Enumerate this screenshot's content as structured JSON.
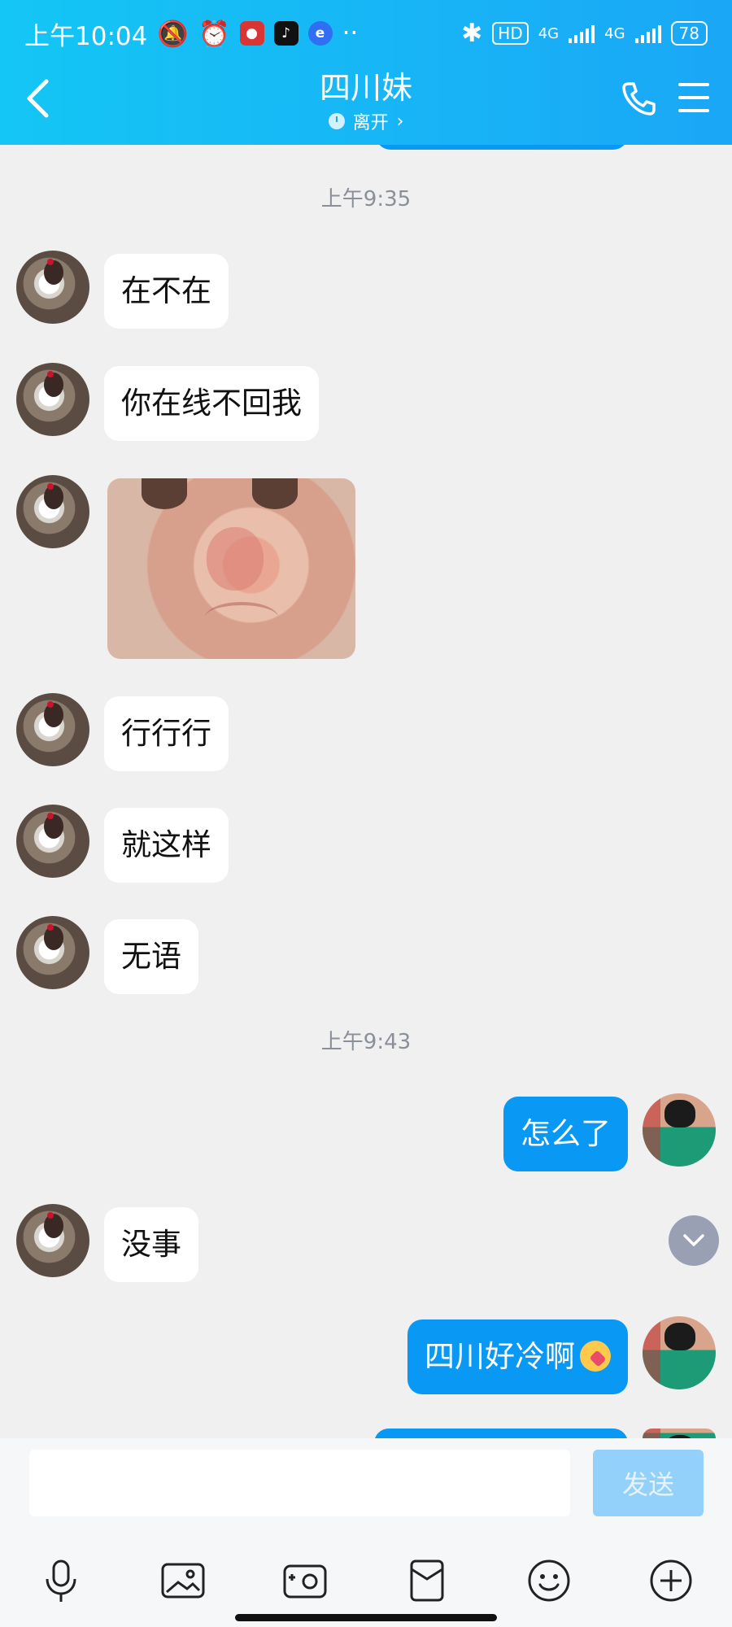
{
  "status_bar": {
    "time": "上午10:04",
    "network_type": "4G",
    "network_type2": "4G",
    "battery": "78",
    "hd": "HD"
  },
  "header": {
    "title": "四川妹",
    "presence": "离开",
    "presence_arrow": "›",
    "back_icon": "chevron-left-icon",
    "call_icon": "phone-icon",
    "menu_icon": "menu-icon"
  },
  "messages": {
    "t1": "上午9:35",
    "m1": "在不在",
    "m2": "你在线不回我",
    "m4": "行行行",
    "m5": "就这样",
    "m6": "无语",
    "t2": "上午9:43",
    "m7": "怎么了",
    "m8": "没事",
    "m9": "四川好冷啊"
  },
  "composer": {
    "input_value": "",
    "send_label": "发送"
  },
  "colors": {
    "header_start": "#14c6f5",
    "header_end": "#1aa7f6",
    "outgoing_bubble": "#0a98f5",
    "incoming_bubble": "#ffffff",
    "send_button_disabled": "#93d1fb"
  }
}
